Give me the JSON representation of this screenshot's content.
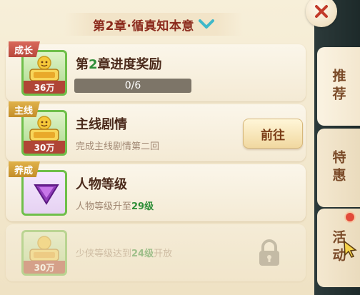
{
  "header": {
    "chapter_title": "第2章·循真知本意"
  },
  "tasks": [
    {
      "tag": "成长",
      "title_prefix": "第",
      "title_highlight": "2",
      "title_suffix": "章进度奖励",
      "reward_amount": "36万",
      "reward_icon": "exp-icon",
      "progress_text": "0/6",
      "progress_fraction": 0
    },
    {
      "tag": "主线",
      "title": "主线剧情",
      "description": "完成主线剧情第二回",
      "reward_amount": "30万",
      "reward_icon": "exp-icon",
      "button_label": "前往"
    },
    {
      "tag": "养成",
      "title": "人物等级",
      "description_prefix": "人物等级升至",
      "description_highlight": "29级",
      "reward_icon": "purple-gem-icon"
    },
    {
      "description_prefix": "少侠等级达到",
      "description_highlight": "24级",
      "description_suffix": "开放",
      "reward_amount": "30万",
      "reward_icon": "exp-icon",
      "locked": true
    }
  ],
  "side_tabs": [
    {
      "label": "推荐"
    },
    {
      "label": "特惠"
    },
    {
      "label": "活动"
    }
  ],
  "colors": {
    "accent_red": "#b04536",
    "highlight_green": "#2f8e38",
    "tab_text": "#7a4a28",
    "item_border": "#6fbf4a"
  }
}
